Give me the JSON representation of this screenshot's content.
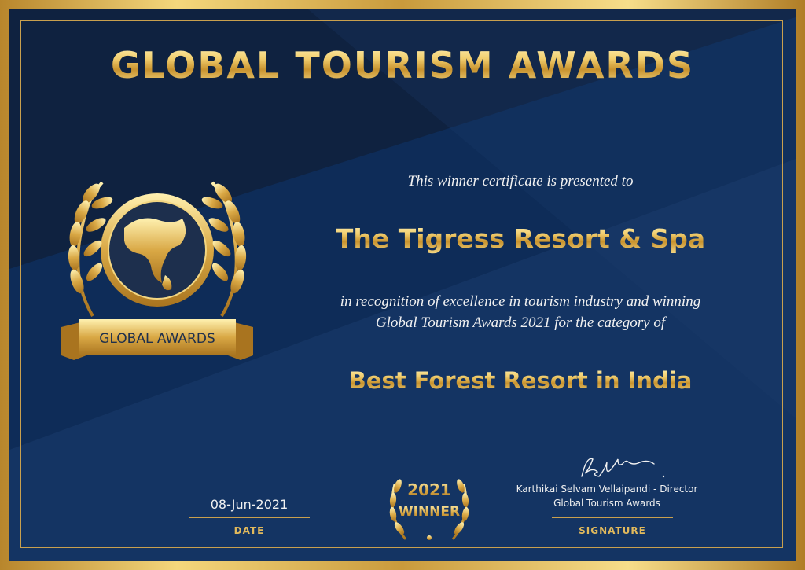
{
  "certificate": {
    "title": "GLOBAL TOURISM AWARDS",
    "presented_text": "This winner certificate is presented to",
    "recipient": "The Tigress Resort & Spa",
    "recognition_line1": "in recognition of excellence in tourism industry and winning",
    "recognition_line2": "Global Tourism Awards 2021 for the category of",
    "category": "Best Forest Resort in India"
  },
  "emblem": {
    "ribbon_text": "GLOBAL AWARDS",
    "icon": "globe-laurel-icon"
  },
  "badge": {
    "year": "2021",
    "label": "WINNER",
    "icon": "laurel-wreath-icon"
  },
  "date": {
    "value": "08-Jun-2021",
    "caption": "DATE"
  },
  "signature": {
    "signer": "Karthikai Selvam Vellaipandi - Director",
    "organization": "Global Tourism Awards",
    "caption": "SIGNATURE",
    "icon": "handwritten-signature-icon"
  },
  "colors": {
    "gold": "#e1b95c",
    "navy": "#13294a",
    "frame": "#c99a3c"
  }
}
